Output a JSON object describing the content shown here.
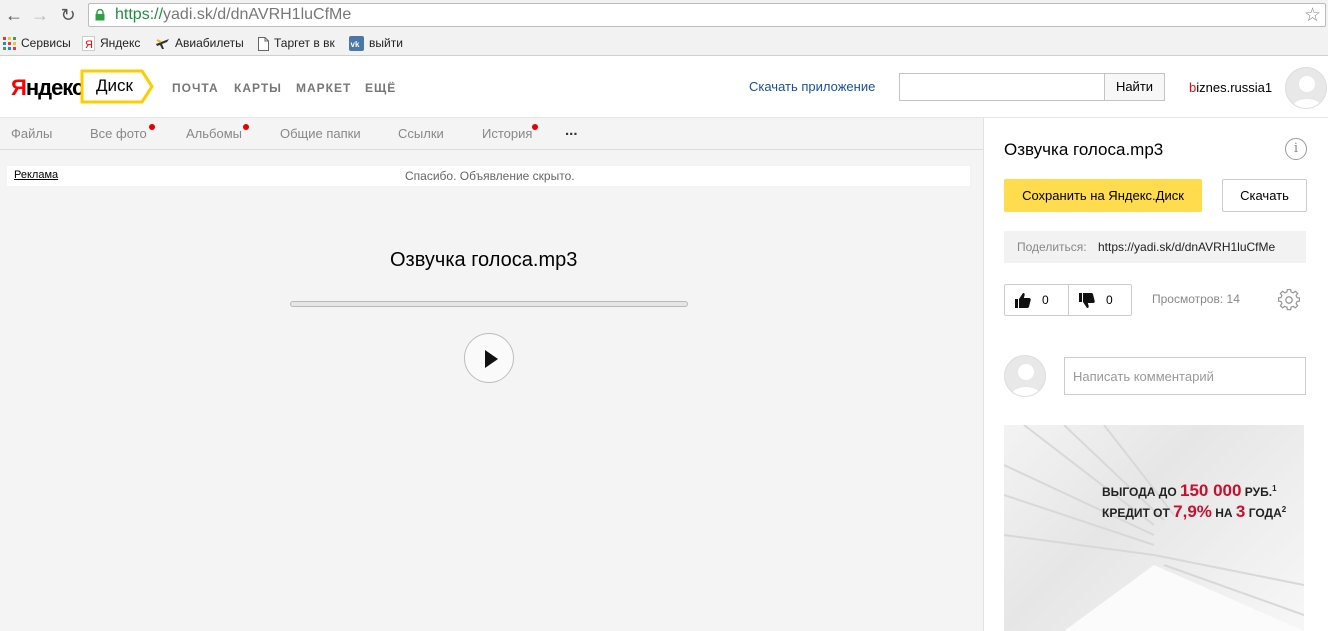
{
  "browser": {
    "url_scheme": "https://",
    "url_rest": "yadi.sk/d/dnAVRH1luCfMe",
    "bookmarks": [
      "Сервисы",
      "Яндекс",
      "Авиабилеты",
      "Таргет в вк",
      "выйти"
    ]
  },
  "header": {
    "logo_first": "Я",
    "logo_rest": "ндекс",
    "service": "Диск",
    "services": [
      "ПОЧТА",
      "КАРТЫ",
      "МАРКЕТ",
      "ЕЩЁ"
    ],
    "download_app": "Скачать приложение",
    "search_button": "Найти",
    "search_value": "",
    "username_first": "b",
    "username_rest": "iznes.russia1"
  },
  "tabs": [
    "Файлы",
    "Все фото",
    "Альбомы",
    "Общие папки",
    "Ссылки",
    "История",
    "..."
  ],
  "main": {
    "ad_label": "Реклама",
    "ad_text": "Спасибо. Объявление скрыто.",
    "file_title": "Озвучка голоса.mp3",
    "progress": 0
  },
  "side": {
    "title": "Озвучка голоса.mp3",
    "info_glyph": "i",
    "save_label": "Сохранить на Яндекс.Диск",
    "download_label": "Скачать",
    "share_label": "Поделиться:",
    "share_link": "https://yadi.sk/d/dnAVRH1luCfMe",
    "likes": "0",
    "dislikes": "0",
    "views": "Просмотров: 14",
    "comment_placeholder": "Написать комментарий",
    "banner_line1_pre": "ВЫГОДА ДО ",
    "banner_line1_num": "150 000",
    "banner_line1_post": " РУБ.",
    "banner_line1_sup": "1",
    "banner_line2_pre": "КРЕДИТ ОТ ",
    "banner_line2_num": "7,9%",
    "banner_line2_mid": " НА ",
    "banner_line2_num2": "3",
    "banner_line2_post": " ГОДА",
    "banner_line2_sup": "2"
  },
  "colors": {
    "accent_yellow": "#ffdb4d",
    "link_blue": "#1a4fa5",
    "logo_red": "#ff0000",
    "notify_dot": "#e60000"
  }
}
